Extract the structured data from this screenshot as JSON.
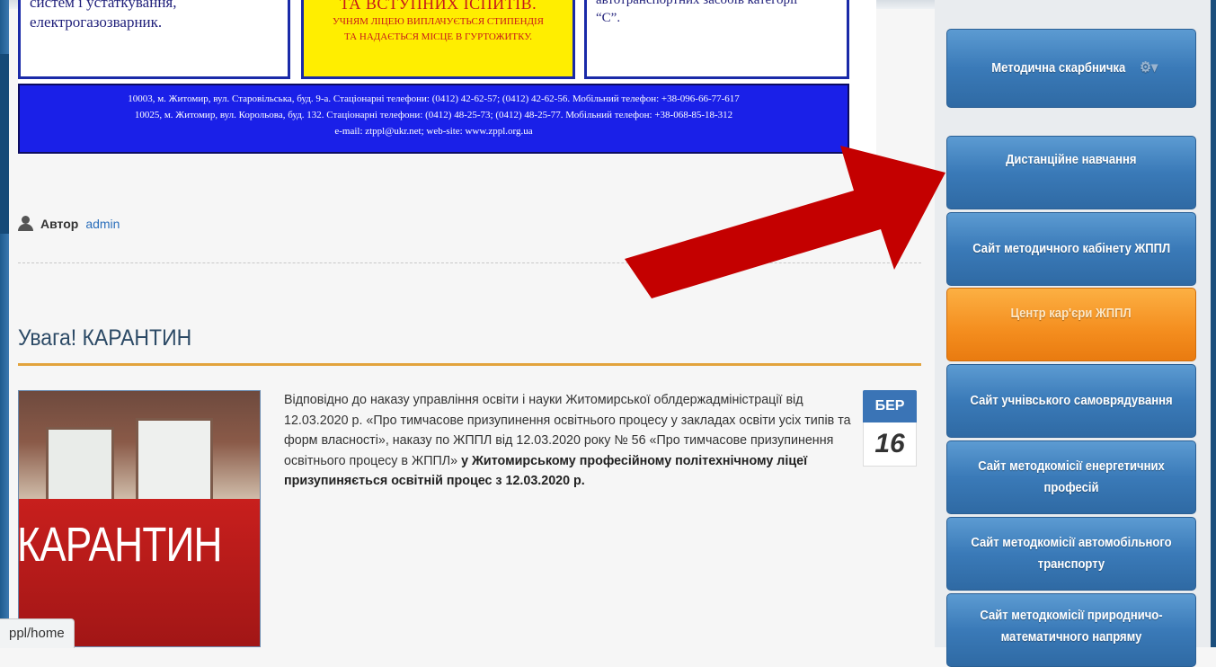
{
  "banner": {
    "box1_line1": "систем і устаткування,",
    "box1_line2": "електрогазозварник.",
    "box2_big": "ТА ВСТУПНИХ ІСПИТІВ.",
    "box2_small1": "УЧНЯМ ЛІЦЕЮ ВИПЛАЧУЄТЬСЯ СТИПЕНДІЯ",
    "box2_small2": "ТА НАДАЄТЬСЯ МІСЦЕ В ГУРТОЖИТКУ.",
    "box3_line1": "автотранспортних засобів категорії",
    "box3_line2": "“С”.",
    "address1": "10003, м. Житомир, вул. Старовільська, буд. 9-а. Стаціонарні телефони: (0412) 42-62-57; (0412) 42-62-56. Мобільний телефон: +38-096-66-77-617",
    "address2": "10025, м. Житомир, вул. Корольова, буд. 132. Стаціонарні телефони: (0412) 48-25-73; (0412) 48-25-77. Мобільний телефон: +38-068-85-18-312",
    "contact": "e-mail: ztppl@ukr.net; web-site: www.zppl.org.ua"
  },
  "author": {
    "label": "Автор",
    "name": "admin"
  },
  "article": {
    "title": "Увага! КАРАНТИН",
    "image_text": "КАРАНТИН",
    "body_normal": "Відповідно до наказу управління освіти і науки Житомирської облдержадміністрації від 12.03.2020 р. «Про тимчасове призупинення освітнього процесу у закладах освіти усіх типів та форм власності», наказу по ЖППЛ від 12.03.2020 року № 56 «Про тимчасове призупинення освітнього процесу в ЖППЛ»",
    "body_bold": "у Житомирському професійному політехнічному ліцеї призупиняється освітній процес з 12.03.2020 р.",
    "date_month": "БЕР",
    "date_day": "16"
  },
  "sidebar": {
    "items": [
      {
        "label": "Методична скарбничка"
      },
      {
        "label": "Дистанційне навчання"
      },
      {
        "label": "Сайт методичного кабінету ЖППЛ"
      },
      {
        "label": "Центр кар'єри ЖППЛ"
      },
      {
        "label": "Сайт учнівського самоврядування"
      },
      {
        "label": "Сайт методкомісії енергетичних професій"
      },
      {
        "label": "Сайт методкомісії автомобільного транспорту"
      },
      {
        "label": "Сайт методкомісії природничо-математичного напряму"
      }
    ]
  },
  "status": {
    "url": "ppl/home"
  },
  "colors": {
    "accent_blue": "#3a7ab8",
    "accent_orange": "#f48d1e",
    "arrow_red": "#c40000",
    "rule_orange": "#e2a33c"
  }
}
